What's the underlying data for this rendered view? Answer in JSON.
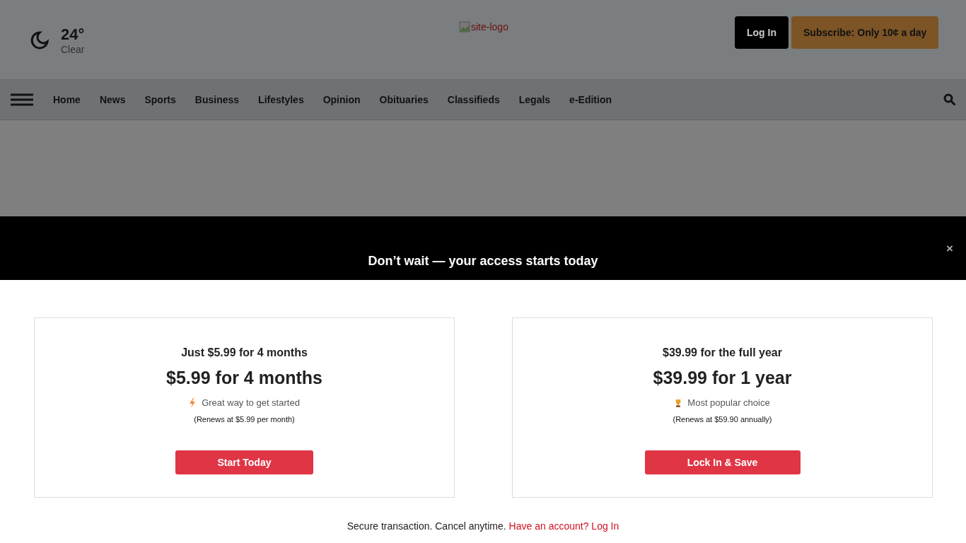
{
  "weather": {
    "temperature": "24°",
    "condition": "Clear"
  },
  "logo": {
    "alt_text": "site-logo"
  },
  "header_buttons": {
    "login": "Log In",
    "subscribe": "Subscribe: Only 10¢ a day"
  },
  "nav": {
    "items": [
      "Home",
      "News",
      "Sports",
      "Business",
      "Lifestyles",
      "Opinion",
      "Obituaries",
      "Classifieds",
      "Legals",
      "e-Edition"
    ]
  },
  "banner": {
    "headline": "Don’t wait — your access starts today",
    "close": "×"
  },
  "offers": [
    {
      "subtitle": "Just $5.99 for 4 months",
      "price": "$5.99 for 4 months",
      "kind": "lightning",
      "tagline": "Great way to get started",
      "renewal": "(Renews at $5.99 per month)",
      "button": "Start Today"
    },
    {
      "subtitle": "$39.99 for the full year",
      "price": "$39.99 for 1 year",
      "kind": "trophy",
      "tagline": "Most popular choice",
      "renewal": "(Renews at $59.90 annually)",
      "button": "Lock In & Save"
    }
  ],
  "footer": {
    "note": "Secure transaction. Cancel anytime.",
    "link": "Have an account? Log In"
  }
}
